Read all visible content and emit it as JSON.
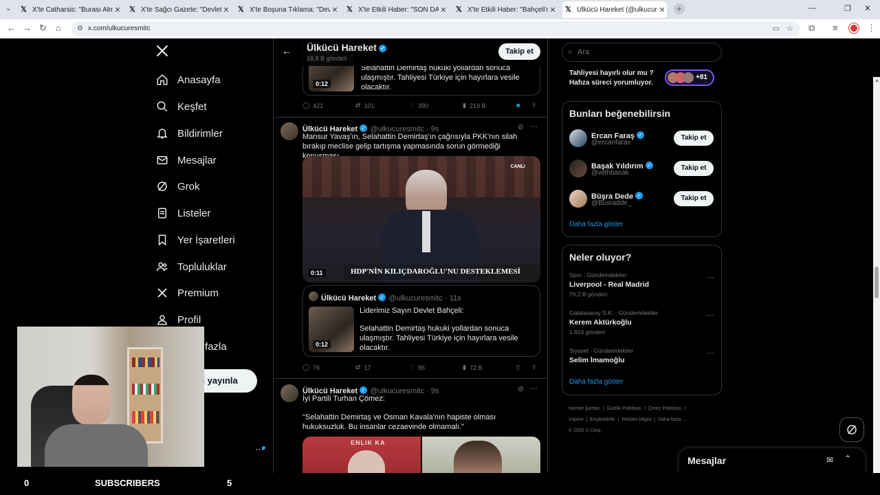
{
  "tabs": [
    {
      "title": "X'te Catharsis: \"Burası Almanya"
    },
    {
      "title": "X'te Sağcı Gazete: \"Devlet Bahç"
    },
    {
      "title": "X'te Boşuna Tıklama: \"Devlet Ba"
    },
    {
      "title": "X'te Etkili Haber: \"SON DAKİKA"
    },
    {
      "title": "X'te Etkili Haber: \"Bahçeli'nin se"
    },
    {
      "title": "Ülkücü Hareket (@ulkucuresmi"
    }
  ],
  "url": "x.com/ulkucuresmitc",
  "nav": {
    "home": "Anasayfa",
    "explore": "Keşfet",
    "notifications": "Bildirimler",
    "messages": "Mesajlar",
    "grok": "Grok",
    "lists": "Listeler",
    "bookmarks": "Yer İşaretleri",
    "communities": "Topluluklar",
    "premium": "Premium",
    "profile": "Profil",
    "more": "Daha fazla",
    "post": "Gönderi yayınla"
  },
  "header": {
    "name": "Ülkücü Hareket",
    "posts": "18,8 B gönderi",
    "follow": "Takip et"
  },
  "tweet0": {
    "quote_text": "Selahattin Demirtaş hukuki yollardan sonuca ulaşmıştır. Tahliyesi Türkiye için hayırlara vesile olacaktır.",
    "duration": "0:12",
    "replies": "421",
    "retweets": "101",
    "likes": "390",
    "views": "219 B"
  },
  "tweet1": {
    "name": "Ülkücü Hareket",
    "handle": "@ulkucuresmitc",
    "time": "9s",
    "text": "Mansur Yavaş'ın, Selahattin Demirtaş'ın çağrısıyla PKK'nın silah bırakıp meclise gelip tartışma yapmasında sorun görmediği konuşması.",
    "video_duration": "0:11",
    "live": "CANLI",
    "banner": "HDP'NİN KILIÇDAROĞLU'NU DESTEKLEMESİ",
    "quote": {
      "name": "Ülkücü Hareket",
      "handle": "@ulkucuresmitc",
      "time": "11s",
      "line1": "Liderimiz Sayın Devlet Bahçeli:",
      "line2": "Selahattin Demirtaş hukuki yollardan sonuca ulaşmıştır. Tahliyesi Türkiye için hayırlara vesile olacaktır.",
      "duration": "0:12"
    },
    "replies": "76",
    "retweets": "17",
    "likes": "86",
    "views": "72 B"
  },
  "tweet2": {
    "name": "Ülkücü Hareket",
    "handle": "@ulkucuresmitc",
    "time": "9s",
    "line1": "İyi Partili Turhan Çömez:",
    "line2": "\"Selahattin Demirtaş ve Osman Kavala'nın hapiste olması hukuksuzluk. Bu insanlar cezaevinde olmamalı.\"",
    "img_text": "ENLIK KA"
  },
  "search": {
    "placeholder": "Ara"
  },
  "trend_top": {
    "text": "Tahliyesi hayırlı olur mu ? Hafıza süreci yorumluyor.",
    "count": "+81"
  },
  "who_to_follow": {
    "title": "Bunları beğenebilirsin",
    "users": [
      {
        "name": "Ercan Faraş",
        "handle": "@ercanfaras",
        "button": "Takip et"
      },
      {
        "name": "Başak Yıldırım",
        "handle": "@withbasak",
        "button": "Takip et"
      },
      {
        "name": "Büşra Dede",
        "handle": "@Busradde_",
        "button": "Takip et"
      }
    ],
    "more": "Daha fazla göster"
  },
  "trends": {
    "title": "Neler oluyor?",
    "items": [
      {
        "context": "Spor · Gündemdekiler",
        "name": "Liverpool - Real Madrid",
        "count": "79,2 B gönderi"
      },
      {
        "context": "Galatasaray S.K. · Gündemdekiler",
        "name": "Kerem Aktürkoğlu",
        "count": "1.653 gönderi"
      },
      {
        "context": "Siyaset · Gündemdekiler",
        "name": "Selim İmamoğlu",
        "count": ""
      }
    ],
    "more": "Daha fazla göster"
  },
  "footer": {
    "l1": "Hizmet Şartları",
    "l2": "Gizlilik Politikası",
    "l3": "Çerez Politikası",
    "l4": "Imprint",
    "l5": "Erişilebilirlik",
    "l6": "Reklam bilgisi",
    "l7": "Daha fazla ...",
    "copy": "© 2025 X Corp."
  },
  "messages_dock": {
    "title": "Mesajlar"
  },
  "stream": {
    "left": "0",
    "label": "SUBSCRIBERS",
    "right": "5"
  }
}
